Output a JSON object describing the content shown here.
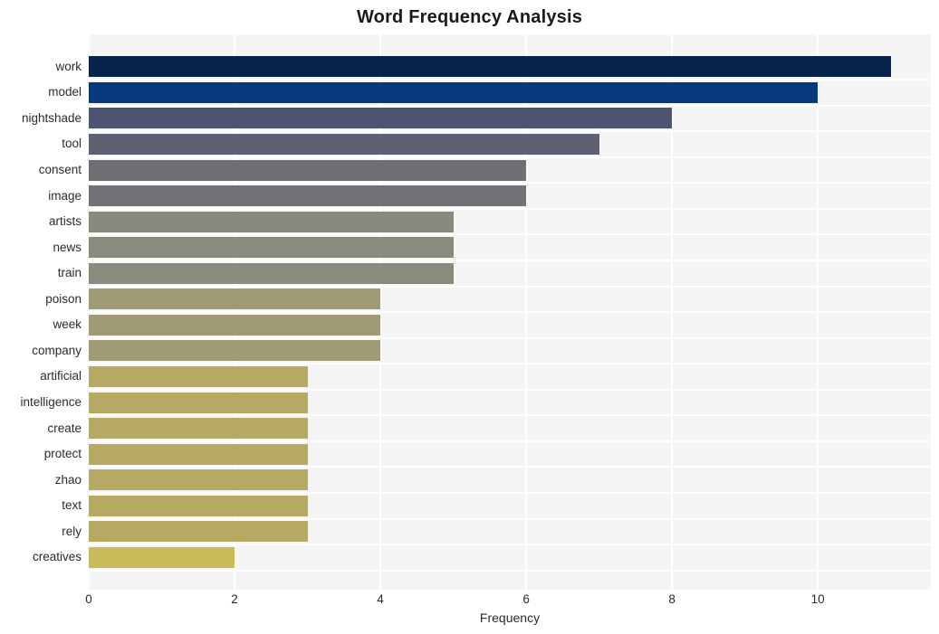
{
  "chart_data": {
    "type": "bar",
    "orientation": "horizontal",
    "title": "Word Frequency Analysis",
    "xlabel": "Frequency",
    "ylabel": "",
    "categories": [
      "work",
      "model",
      "nightshade",
      "tool",
      "consent",
      "image",
      "artists",
      "news",
      "train",
      "poison",
      "week",
      "company",
      "artificial",
      "intelligence",
      "create",
      "protect",
      "zhao",
      "text",
      "rely",
      "creatives"
    ],
    "values": [
      11,
      10,
      8,
      7,
      6,
      6,
      5,
      5,
      5,
      4,
      4,
      4,
      3,
      3,
      3,
      3,
      3,
      3,
      3,
      2
    ],
    "bar_colors": [
      "#06234b",
      "#063a7c",
      "#4c5472",
      "#5d6172",
      "#6e6f73",
      "#717276",
      "#898a7e",
      "#8a8a7e",
      "#8a8a7e",
      "#a09a76",
      "#a09a76",
      "#a09a76",
      "#b5a963",
      "#b5a963",
      "#b5a963",
      "#b5a963",
      "#b5a963",
      "#b5a963",
      "#b5a963",
      "#c9bc58"
    ],
    "xticks": [
      0,
      2,
      4,
      6,
      8,
      10
    ],
    "xlim": [
      0,
      11.55
    ],
    "grid": true,
    "grid_color": "#ffffff",
    "plot_background": "#f5f5f6",
    "figure_background": "#ffffff",
    "legend": null
  },
  "axis": {
    "x_tick_labels": [
      "0",
      "2",
      "4",
      "6",
      "8",
      "10"
    ],
    "y_tick_labels": [
      "work",
      "model",
      "nightshade",
      "tool",
      "consent",
      "image",
      "artists",
      "news",
      "train",
      "poison",
      "week",
      "company",
      "artificial",
      "intelligence",
      "create",
      "protect",
      "zhao",
      "text",
      "rely",
      "creatives"
    ]
  }
}
